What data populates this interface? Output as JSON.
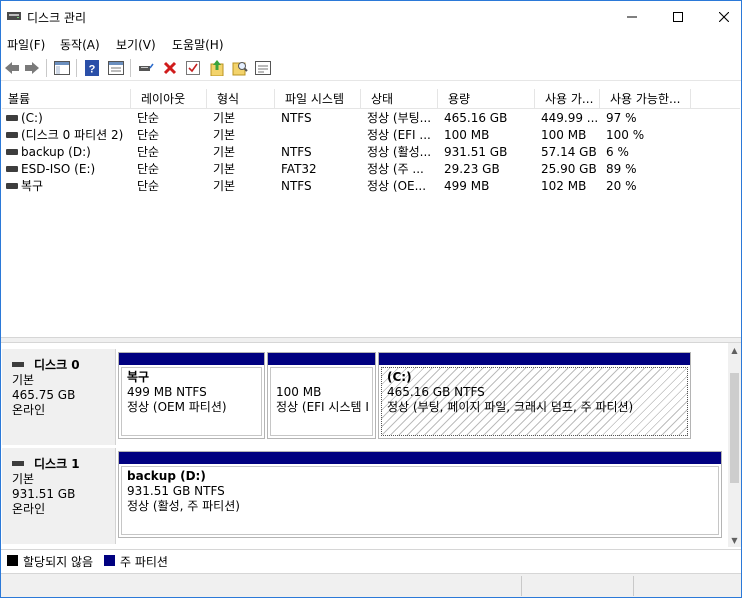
{
  "window": {
    "title": "디스크 관리"
  },
  "menu": [
    "파일(F)",
    "동작(A)",
    "보기(V)",
    "도움말(H)"
  ],
  "toolbar": {
    "buttons": [
      "back-icon",
      "forward-icon",
      "console-tree-icon",
      "help-icon",
      "properties-icon",
      "connect-icon",
      "delete-icon",
      "check-icon",
      "import-icon",
      "search-icon",
      "rescan-icon"
    ]
  },
  "volume_list": {
    "columns": [
      "볼륨",
      "레이아웃",
      "형식",
      "파일 시스템",
      "상태",
      "용량",
      "사용 가...",
      "사용 가능한..."
    ],
    "rows": [
      [
        "(C:)",
        "단순",
        "기본",
        "NTFS",
        "정상 (부팅...",
        "465.16 GB",
        "449.99 ...",
        "97 %"
      ],
      [
        "(디스크 0 파티션 2)",
        "단순",
        "기본",
        "",
        "정상 (EFI ...",
        "100 MB",
        "100 MB",
        "100 %"
      ],
      [
        "backup (D:)",
        "단순",
        "기본",
        "NTFS",
        "정상 (활성...",
        "931.51 GB",
        "57.14 GB",
        "6 %"
      ],
      [
        "ESD-ISO (E:)",
        "단순",
        "기본",
        "FAT32",
        "정상 (주 ...",
        "29.23 GB",
        "25.90 GB",
        "89 %"
      ],
      [
        "복구",
        "단순",
        "기본",
        "NTFS",
        "정상 (OE...",
        "499 MB",
        "102 MB",
        "20 %"
      ]
    ]
  },
  "disks": [
    {
      "name": "디스크 0",
      "type": "기본",
      "size": "465.75 GB",
      "status": "온라인",
      "partitions": [
        {
          "title": "복구",
          "size": "499 MB NTFS",
          "status": "정상 (OEM 파티션)"
        },
        {
          "title": "",
          "size": "100 MB",
          "status": "정상 (EFI 시스템 I"
        },
        {
          "title": "(C:)",
          "size": "465.16 GB NTFS",
          "status": "정상 (부팅, 페이지 파일, 크래시 덤프, 주 파티션)"
        }
      ]
    },
    {
      "name": "디스크 1",
      "type": "기본",
      "size": "931.51 GB",
      "status": "온라인",
      "partitions": [
        {
          "title": "backup  (D:)",
          "size": "931.51 GB NTFS",
          "status": "정상 (활성, 주 파티션)"
        }
      ]
    }
  ],
  "legend": [
    {
      "label": "할당되지 않음",
      "color": "#000000"
    },
    {
      "label": "주 파티션",
      "color": "#000080"
    }
  ],
  "colors": {
    "partition_bar": "#000080",
    "window_border": "#2b79d8"
  }
}
